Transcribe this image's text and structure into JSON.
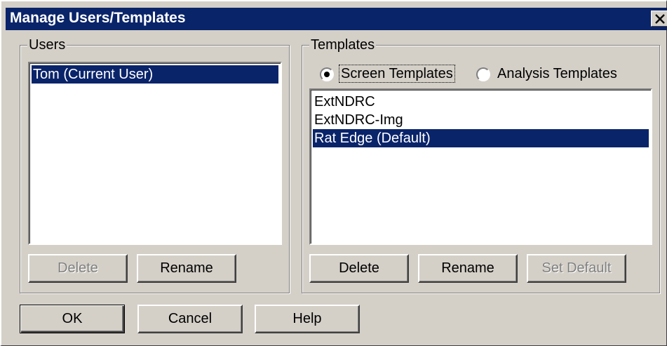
{
  "window": {
    "title": "Manage Users/Templates",
    "close_icon": "close-icon"
  },
  "users": {
    "group_label": "Users",
    "items": [
      "Tom (Current User)"
    ],
    "selected_index": 0,
    "buttons": {
      "delete": "Delete",
      "rename": "Rename"
    },
    "delete_enabled": false
  },
  "templates": {
    "group_label": "Templates",
    "radio_screen": "Screen Templates",
    "radio_analysis": "Analysis Templates",
    "selected_radio": "screen",
    "items": [
      "ExtNDRC",
      "ExtNDRC-Img",
      "Rat Edge (Default)"
    ],
    "selected_index": 2,
    "buttons": {
      "delete": "Delete",
      "rename": "Rename",
      "set_default": "Set Default"
    },
    "set_default_enabled": false
  },
  "footer": {
    "ok": "OK",
    "cancel": "Cancel",
    "help": "Help"
  },
  "colors": {
    "face": "#d4d0c8",
    "selection": "#0a246a",
    "titlebar": "#0a246a"
  }
}
